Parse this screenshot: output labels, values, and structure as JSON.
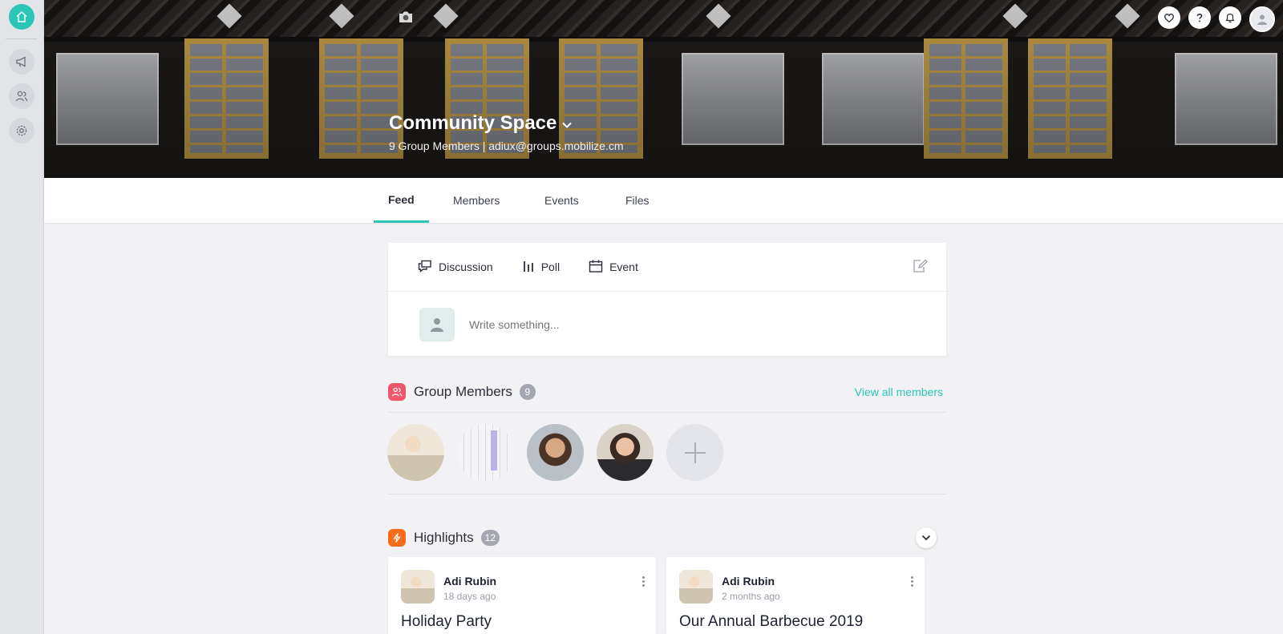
{
  "app": {
    "rail": {
      "items": [
        {
          "name": "home-icon",
          "label": "Home"
        },
        {
          "name": "megaphone-icon",
          "label": "Announcements"
        },
        {
          "name": "users-icon",
          "label": "Groups"
        },
        {
          "name": "gear-icon",
          "label": "Settings"
        }
      ]
    },
    "accent_color": "#2bc6b8"
  },
  "header": {
    "group_title": "Community Space",
    "group_subtitle": "9 Group Members | adiux@groups.mobilize.cm",
    "top_icons": [
      "heart-icon",
      "help-icon",
      "bell-icon",
      "user-avatar"
    ]
  },
  "tabs": [
    {
      "label": "Feed",
      "active": true
    },
    {
      "label": "Members",
      "active": false
    },
    {
      "label": "Events",
      "active": false
    },
    {
      "label": "Files",
      "active": false
    }
  ],
  "composer": {
    "types": [
      {
        "label": "Discussion",
        "icon": "discussion-icon"
      },
      {
        "label": "Poll",
        "icon": "poll-icon"
      },
      {
        "label": "Event",
        "icon": "calendar-icon"
      }
    ],
    "placeholder": "Write something..."
  },
  "group_members": {
    "title": "Group Members",
    "count": "9",
    "view_all": "View all members",
    "icon_color": "#f0566b"
  },
  "highlights": {
    "title": "Highlights",
    "count": "12",
    "icon_color": "#f96c1c",
    "cards": [
      {
        "author": "Adi Rubin",
        "time": "18 days ago",
        "title": "Holiday Party"
      },
      {
        "author": "Adi Rubin",
        "time": "2 months ago",
        "title": "Our Annual Barbecue 2019"
      }
    ]
  }
}
